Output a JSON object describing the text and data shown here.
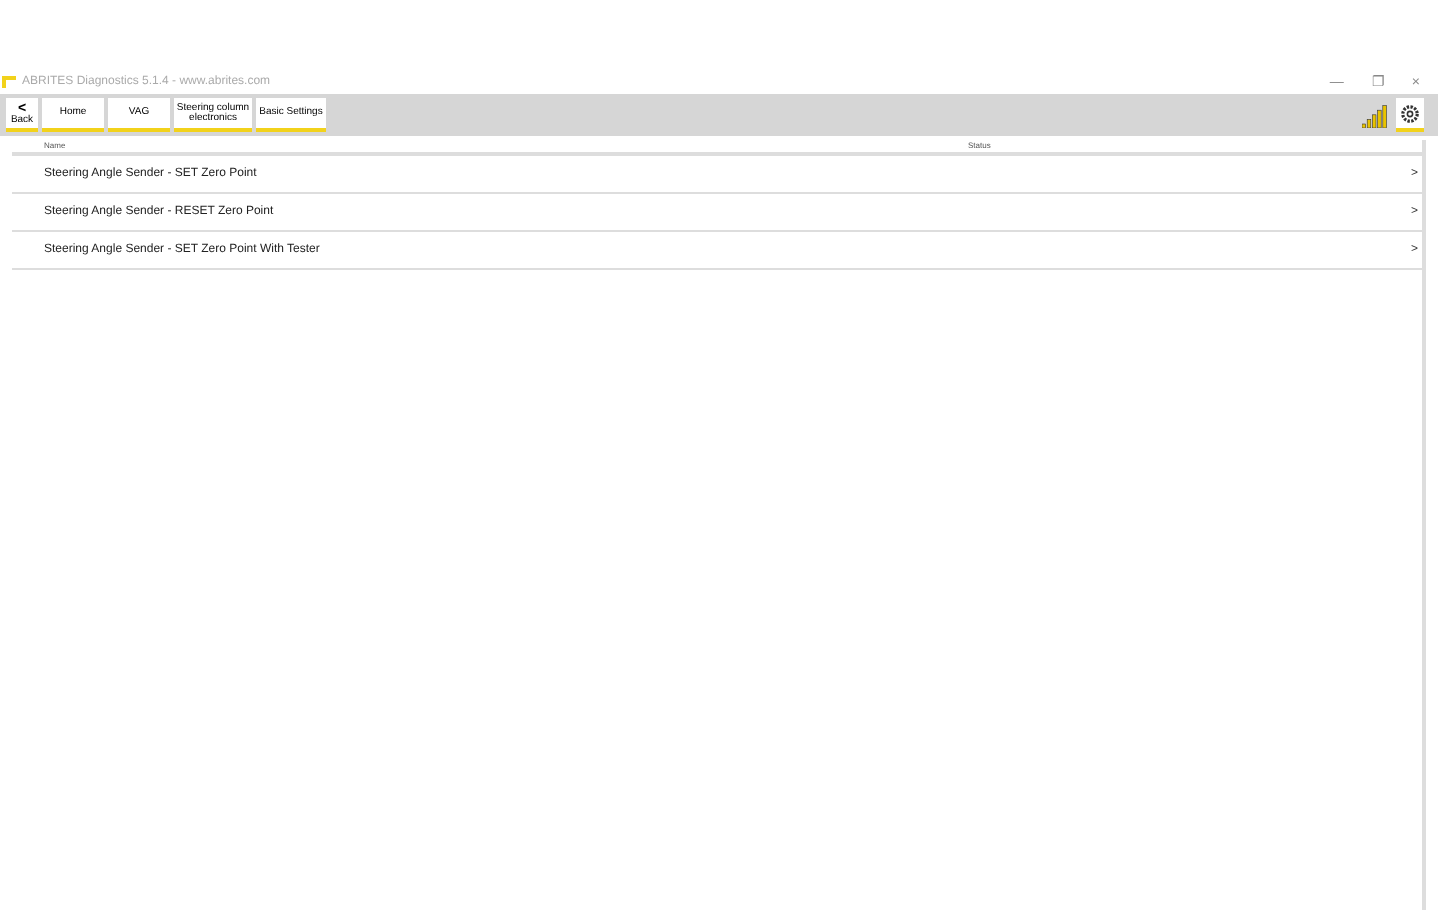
{
  "window": {
    "title": "ABRITES Diagnostics 5.1.4 - www.abrites.com",
    "controls": [
      "—",
      "❐",
      "×"
    ]
  },
  "toolbar": {
    "back": {
      "icon": "<",
      "label": "Back"
    },
    "breadcrumbs": [
      "Home",
      "VAG",
      "Steering column electronics",
      "Basic Settings"
    ]
  },
  "table": {
    "columns": [
      "Name",
      "Status"
    ],
    "rows": [
      {
        "name": "Steering Angle Sender - SET Zero Point",
        "arrow": ">"
      },
      {
        "name": "Steering Angle Sender - RESET Zero Point",
        "arrow": ">"
      },
      {
        "name": "Steering Angle Sender - SET Zero Point With Tester",
        "arrow": ">"
      }
    ]
  }
}
